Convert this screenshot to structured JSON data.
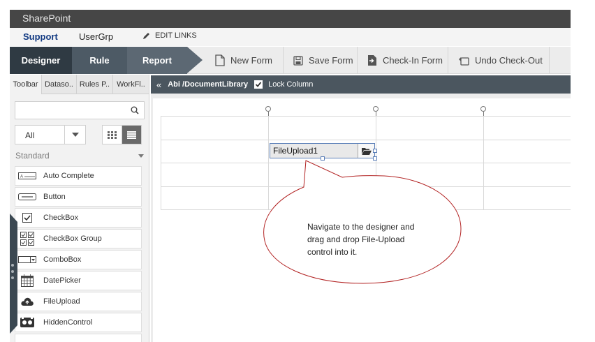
{
  "app": {
    "title": "SharePoint"
  },
  "subnav": {
    "site": "Support",
    "group": "UserGrp",
    "edit_links": "EDIT LINKS"
  },
  "ribbon": {
    "tabs": [
      "Designer",
      "Rule",
      "Report"
    ],
    "tools": {
      "new_form": "New Form",
      "save_form": "Save Form",
      "check_in": "Check-In Form",
      "undo_check_out": "Undo Check-Out"
    }
  },
  "leftpanel": {
    "tabs": [
      "Toolbar",
      "Dataso..",
      "Rules P..",
      "WorkFl.."
    ],
    "search": {
      "placeholder": ""
    },
    "filter": {
      "selected": "All"
    },
    "section": "Standard",
    "controls": [
      {
        "label": "Auto Complete",
        "icon": "auto-complete-icon"
      },
      {
        "label": "Button",
        "icon": "button-control-icon"
      },
      {
        "label": "CheckBox",
        "icon": "checkbox-icon"
      },
      {
        "label": "CheckBox Group",
        "icon": "checkbox-group-icon"
      },
      {
        "label": "ComboBox",
        "icon": "combobox-icon"
      },
      {
        "label": "DatePicker",
        "icon": "calendar-icon"
      },
      {
        "label": "FileUpload",
        "icon": "cloud-upload-icon"
      },
      {
        "label": "HiddenControl",
        "icon": "hidden-control-icon"
      }
    ]
  },
  "pathbar": {
    "path": "Abi /DocumentLibrary",
    "lock_column": "Lock Column"
  },
  "canvas": {
    "field_name": "FileUpload1"
  },
  "callout": {
    "lines": [
      "Navigate to the designer and",
      "drag and drop File-Upload",
      "control into it."
    ]
  },
  "colors": {
    "topbar": "#464646",
    "tab_active": "#2f3a43",
    "path_bar": "#4b565f",
    "callout_stroke": "#b22222",
    "site_link": "#123a82"
  }
}
